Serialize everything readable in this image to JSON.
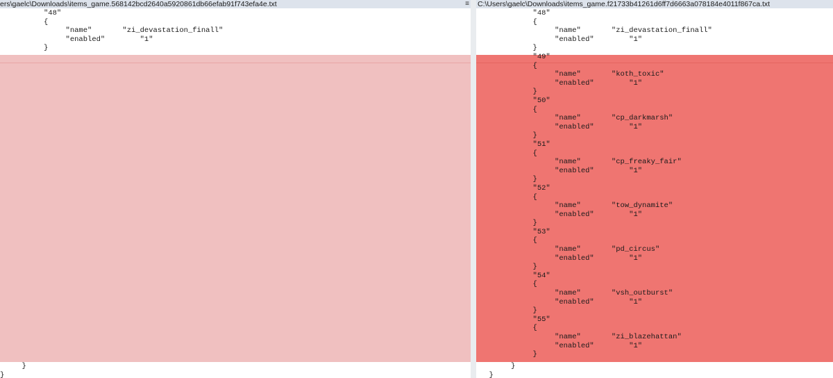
{
  "left_pane": {
    "file_path": "ers\\gaelc\\Downloads\\items_game.568142bcd2640a5920861db66efab91f743efa4e.txt",
    "code_top": "          \"48\"\n          {\n               \"name\"       \"zi_devastation_finall\"\n               \"enabled\"        \"1\"\n          }",
    "code_bottom": "     }\n}"
  },
  "right_pane": {
    "file_path": "C:\\Users\\gaelc\\Downloads\\items_game.f21733b41261d6ff7d6663a078184e4011f867ca.txt",
    "code_top": "               \"48\"\n               {\n                    \"name\"       \"zi_devastation_finall\"\n                    \"enabled\"        \"1\"\n               }",
    "code_diff": "               \"49\"\n               {\n                    \"name\"       \"koth_toxic\"\n                    \"enabled\"        \"1\"\n               }\n               \"50\"\n               {\n                    \"name\"       \"cp_darkmarsh\"\n                    \"enabled\"        \"1\"\n               }\n               \"51\"\n               {\n                    \"name\"       \"cp_freaky_fair\"\n                    \"enabled\"        \"1\"\n               }\n               \"52\"\n               {\n                    \"name\"       \"tow_dynamite\"\n                    \"enabled\"        \"1\"\n               }\n               \"53\"\n               {\n                    \"name\"       \"pd_circus\"\n                    \"enabled\"        \"1\"\n               }\n               \"54\"\n               {\n                    \"name\"       \"vsh_outburst\"\n                    \"enabled\"        \"1\"\n               }\n               \"55\"\n               {\n                    \"name\"       \"zi_blazehattan\"\n                    \"enabled\"        \"1\"\n               }",
    "code_bottom": "          }\n     }"
  },
  "colors": {
    "header_bg": "#dde3ec",
    "left_diff_bg": "#f0c0c0",
    "right_diff_bg": "#ef7571"
  },
  "icons": {
    "pane_menu": "hamburger-menu-icon"
  }
}
